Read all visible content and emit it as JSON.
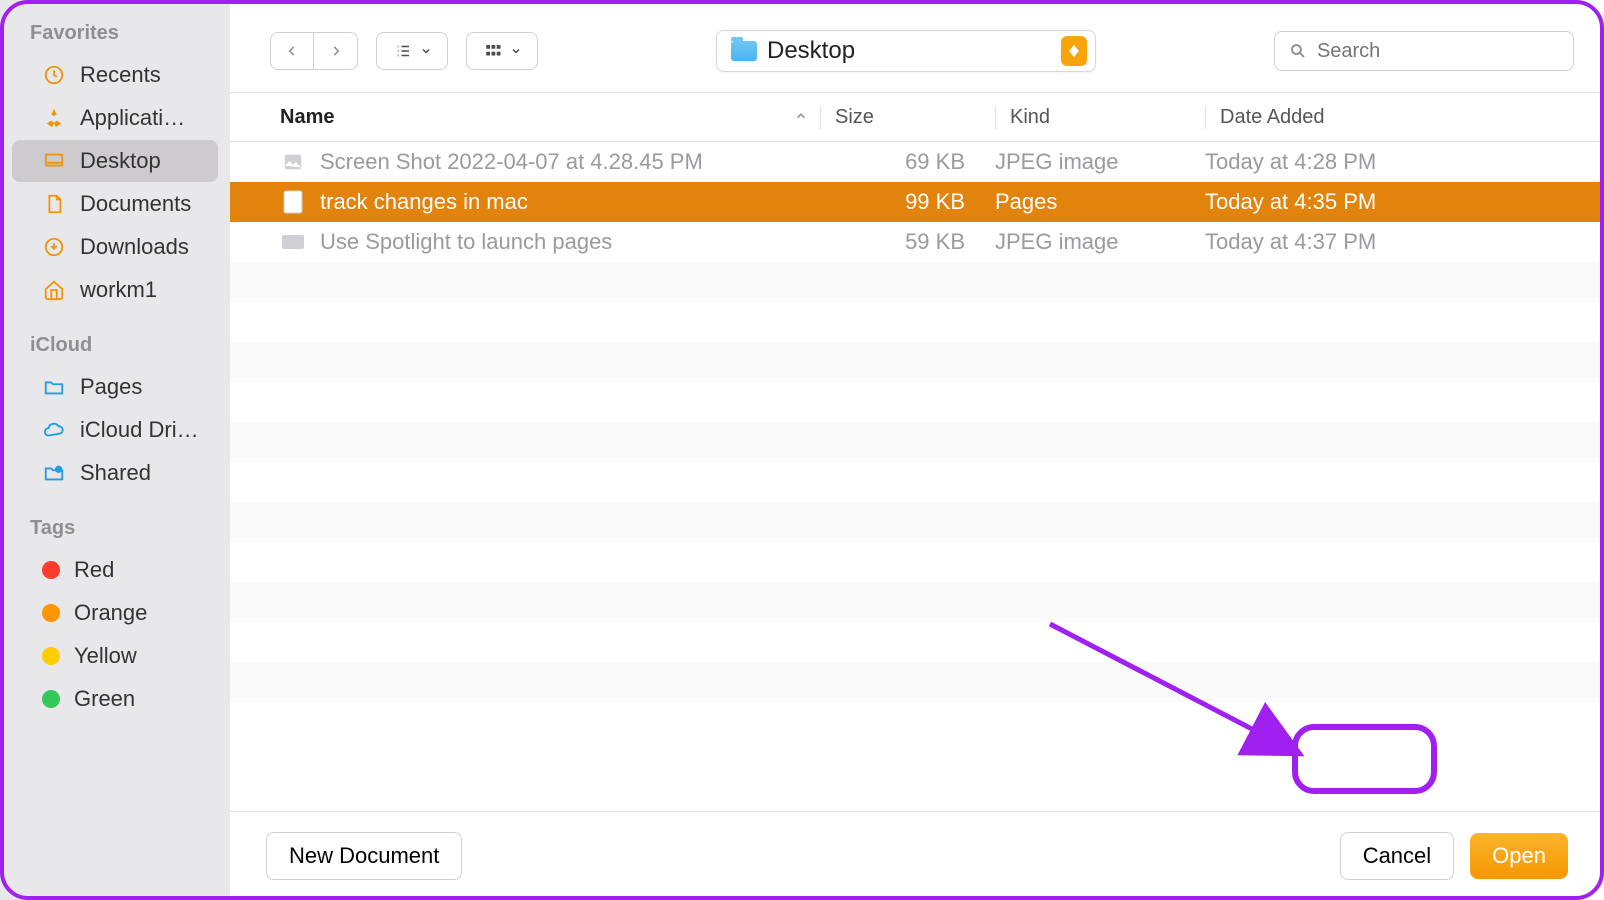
{
  "sidebar": {
    "sections": [
      {
        "title": "Favorites",
        "items": [
          {
            "icon": "clock",
            "label": "Recents",
            "selected": false
          },
          {
            "icon": "apps",
            "label": "Applicati…",
            "selected": false
          },
          {
            "icon": "desktop",
            "label": "Desktop",
            "selected": true
          },
          {
            "icon": "document",
            "label": "Documents",
            "selected": false
          },
          {
            "icon": "download",
            "label": "Downloads",
            "selected": false
          },
          {
            "icon": "home",
            "label": "workm1",
            "selected": false
          }
        ]
      },
      {
        "title": "iCloud",
        "items": [
          {
            "icon": "pages",
            "label": "Pages",
            "selected": false
          },
          {
            "icon": "cloud",
            "label": "iCloud Dri…",
            "selected": false
          },
          {
            "icon": "shared",
            "label": "Shared",
            "selected": false
          }
        ]
      },
      {
        "title": "Tags",
        "items": [
          {
            "icon": "tag",
            "color": "#ff3b30",
            "label": "Red"
          },
          {
            "icon": "tag",
            "color": "#ff9500",
            "label": "Orange"
          },
          {
            "icon": "tag",
            "color": "#ffcc00",
            "label": "Yellow"
          },
          {
            "icon": "tag",
            "color": "#34c759",
            "label": "Green"
          }
        ]
      }
    ]
  },
  "toolbar": {
    "location": "Desktop",
    "search_placeholder": "Search"
  },
  "columns": {
    "name": "Name",
    "size": "Size",
    "kind": "Kind",
    "date": "Date Added"
  },
  "files": [
    {
      "name": "Screen Shot 2022-04-07 at 4.28.45 PM",
      "size": "69 KB",
      "kind": "JPEG image",
      "date": "Today at 4:28 PM",
      "state": "dim",
      "icon": "img"
    },
    {
      "name": "track changes in mac",
      "size": "99 KB",
      "kind": "Pages",
      "date": "Today at 4:35 PM",
      "state": "selected",
      "icon": "doc"
    },
    {
      "name": "Use Spotlight to launch pages",
      "size": "59 KB",
      "kind": "JPEG image",
      "date": "Today at 4:37 PM",
      "state": "dim",
      "icon": "kb"
    }
  ],
  "footer": {
    "new_doc": "New Document",
    "cancel": "Cancel",
    "open": "Open"
  }
}
